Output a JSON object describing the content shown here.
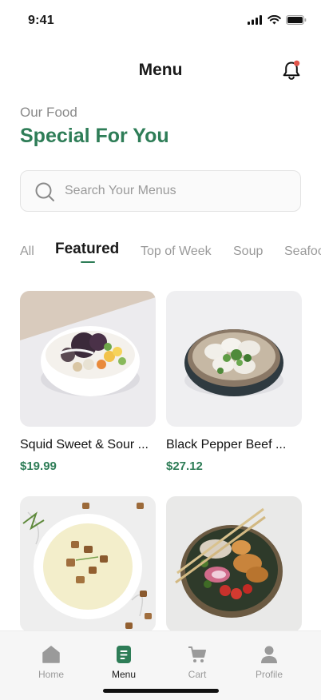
{
  "status_bar": {
    "time": "9:41"
  },
  "header": {
    "title": "Menu"
  },
  "intro": {
    "eyebrow": "Our Food",
    "headline": "Special For You"
  },
  "search": {
    "placeholder": "Search Your Menus",
    "value": ""
  },
  "tabs": [
    {
      "label": "All"
    },
    {
      "label": "Featured",
      "active": true
    },
    {
      "label": "Top of Week"
    },
    {
      "label": "Soup"
    },
    {
      "label": "Seafood"
    }
  ],
  "menu_items": [
    {
      "name": "Squid Sweet & Sour ...",
      "price": "$19.99",
      "image": "rice-bowl-photo"
    },
    {
      "name": "Black Pepper Beef ...",
      "price": "$27.12",
      "image": "dumpling-bowl-photo"
    },
    {
      "name": "",
      "price": "",
      "image": "cream-soup-photo"
    },
    {
      "name": "",
      "price": "",
      "image": "poke-bowl-photo"
    }
  ],
  "bottom_nav": [
    {
      "label": "Home",
      "icon": "home-icon"
    },
    {
      "label": "Menu",
      "icon": "menu-icon",
      "active": true
    },
    {
      "label": "Cart",
      "icon": "cart-icon"
    },
    {
      "label": "Profile",
      "icon": "profile-icon"
    }
  ],
  "colors": {
    "accent": "#2e7d57",
    "muted": "#9a9a9a",
    "notification": "#e2554b"
  }
}
